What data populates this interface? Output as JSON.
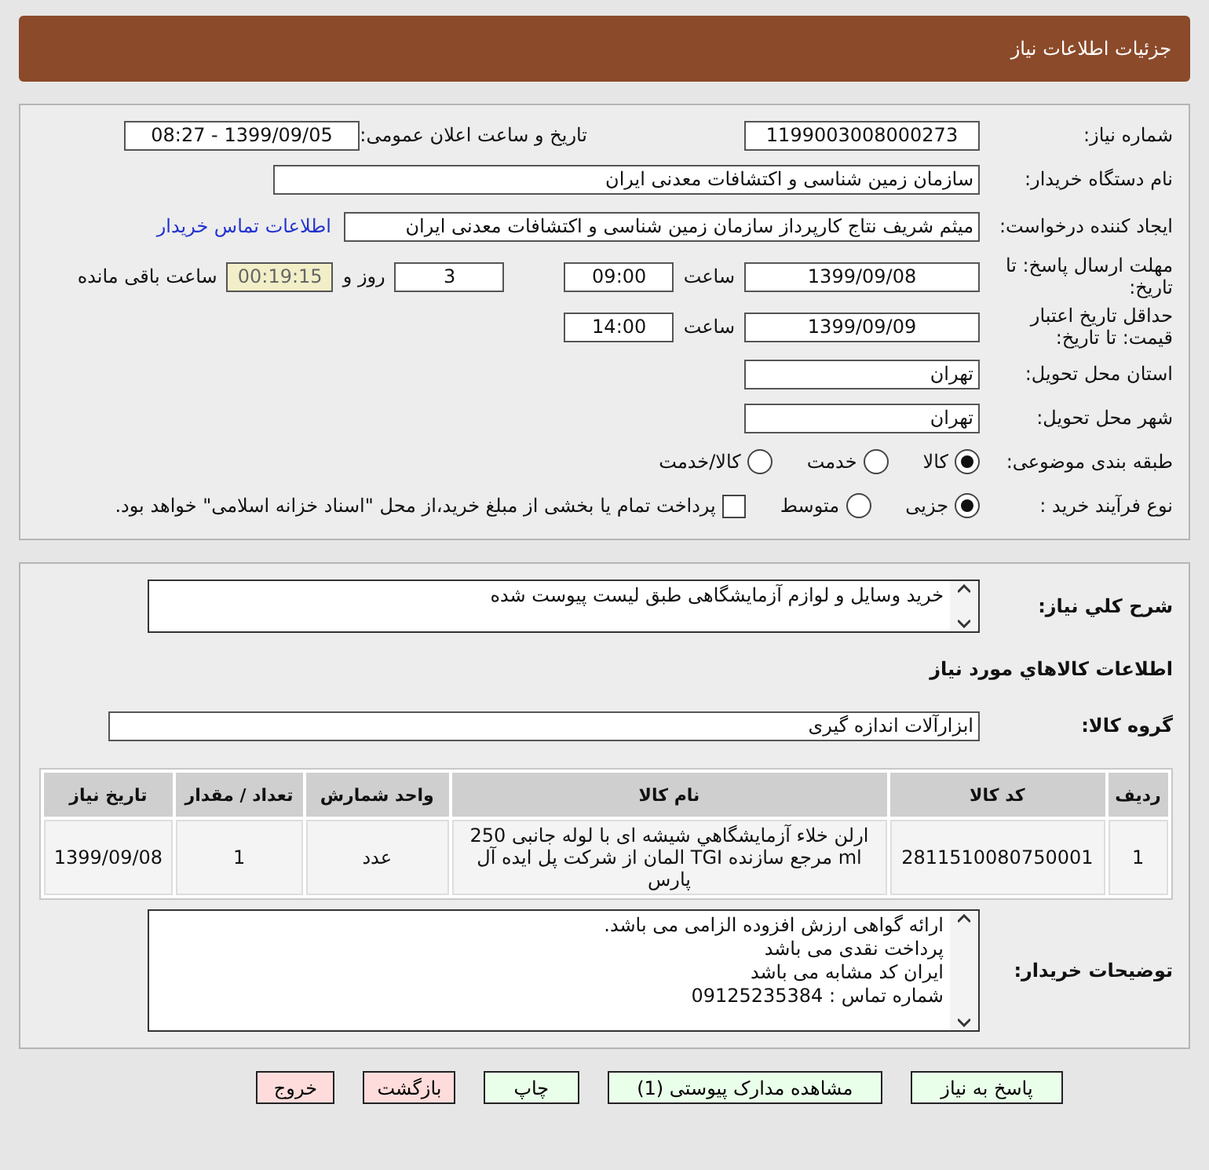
{
  "header": {
    "title": "جزئیات اطلاعات نیاز"
  },
  "need_number": {
    "label": "شماره نیاز:",
    "value": "1199003008000273"
  },
  "announce": {
    "label": "تاریخ و ساعت اعلان عمومی:",
    "value": "1399/09/05 - 08:27"
  },
  "buyer": {
    "label": "نام دستگاه خریدار:",
    "value": "سازمان زمین شناسی و اکتشافات معدنی ایران"
  },
  "creator": {
    "label": "ایجاد کننده درخواست:",
    "value": "میثم شریف نتاج کارپرداز سازمان زمین شناسی و اکتشافات معدنی ایران",
    "link": "اطلاعات تماس خریدار"
  },
  "deadline": {
    "label": "مهلت ارسال پاسخ: تا تاریخ:",
    "date": "1399/09/08",
    "time_label": "ساعت",
    "time": "09:00",
    "days": "3",
    "days_label": "روز و",
    "remaining": "00:19:15",
    "remaining_label": "ساعت باقی مانده"
  },
  "validity": {
    "label": "حداقل تاریخ اعتبار قیمت: تا تاریخ:",
    "date": "1399/09/09",
    "time_label": "ساعت",
    "time": "14:00"
  },
  "province": {
    "label": "استان محل تحویل:",
    "value": "تهران"
  },
  "city": {
    "label": "شهر محل تحویل:",
    "value": "تهران"
  },
  "category": {
    "label": "طبقه بندی موضوعی:",
    "options": [
      {
        "label": "کالا",
        "selected": true
      },
      {
        "label": "خدمت",
        "selected": false
      },
      {
        "label": "کالا/خدمت",
        "selected": false
      }
    ]
  },
  "process": {
    "label": "نوع فرآیند خرید :",
    "options": [
      {
        "label": "جزیی",
        "selected": true
      },
      {
        "label": "متوسط",
        "selected": false
      }
    ],
    "payment": {
      "label": "پرداخت تمام یا بخشی از مبلغ خرید،از محل \"اسناد خزانه اسلامی\" خواهد بود.",
      "checked": false
    }
  },
  "summary": {
    "label": "شرح کلي نياز:",
    "value": "خرید وسایل و لوازم آزمایشگاهی طبق لیست پیوست شده"
  },
  "goods_heading": "اطلاعات کالاهاي مورد نياز",
  "group": {
    "label": "گروه کالا:",
    "value": "ابزارآلات اندازه گیری"
  },
  "table": {
    "columns": [
      "ردیف",
      "کد کالا",
      "نام کالا",
      "واحد شمارش",
      "تعداد / مقدار",
      "تاریخ نیاز"
    ],
    "rows": [
      [
        "1",
        "2811510080750001",
        "ارلن خلاء آزمايشگاهي شیشه ای با لوله جانبی 250 ml مرجع سازنده TGI المان از شرکت پل ایده آل پارس",
        "عدد",
        "1",
        "1399/09/08"
      ]
    ]
  },
  "notes": {
    "label": "توضیحات خریدار:",
    "lines": [
      "ارائه گواهی ارزش افزوده الزامی می باشد.",
      "پرداخت نقدی می باشد",
      "ایران کد مشابه می باشد",
      "شماره تماس : 09125235384"
    ]
  },
  "buttons": [
    {
      "label": "پاسخ به نیاز",
      "kind": "normal"
    },
    {
      "label": "مشاهده مدارک پیوستی (1)",
      "kind": "normal"
    },
    {
      "label": "چاپ",
      "kind": "normal"
    },
    {
      "label": "بازگشت",
      "kind": "danger"
    },
    {
      "label": "خروج",
      "kind": "danger"
    }
  ]
}
